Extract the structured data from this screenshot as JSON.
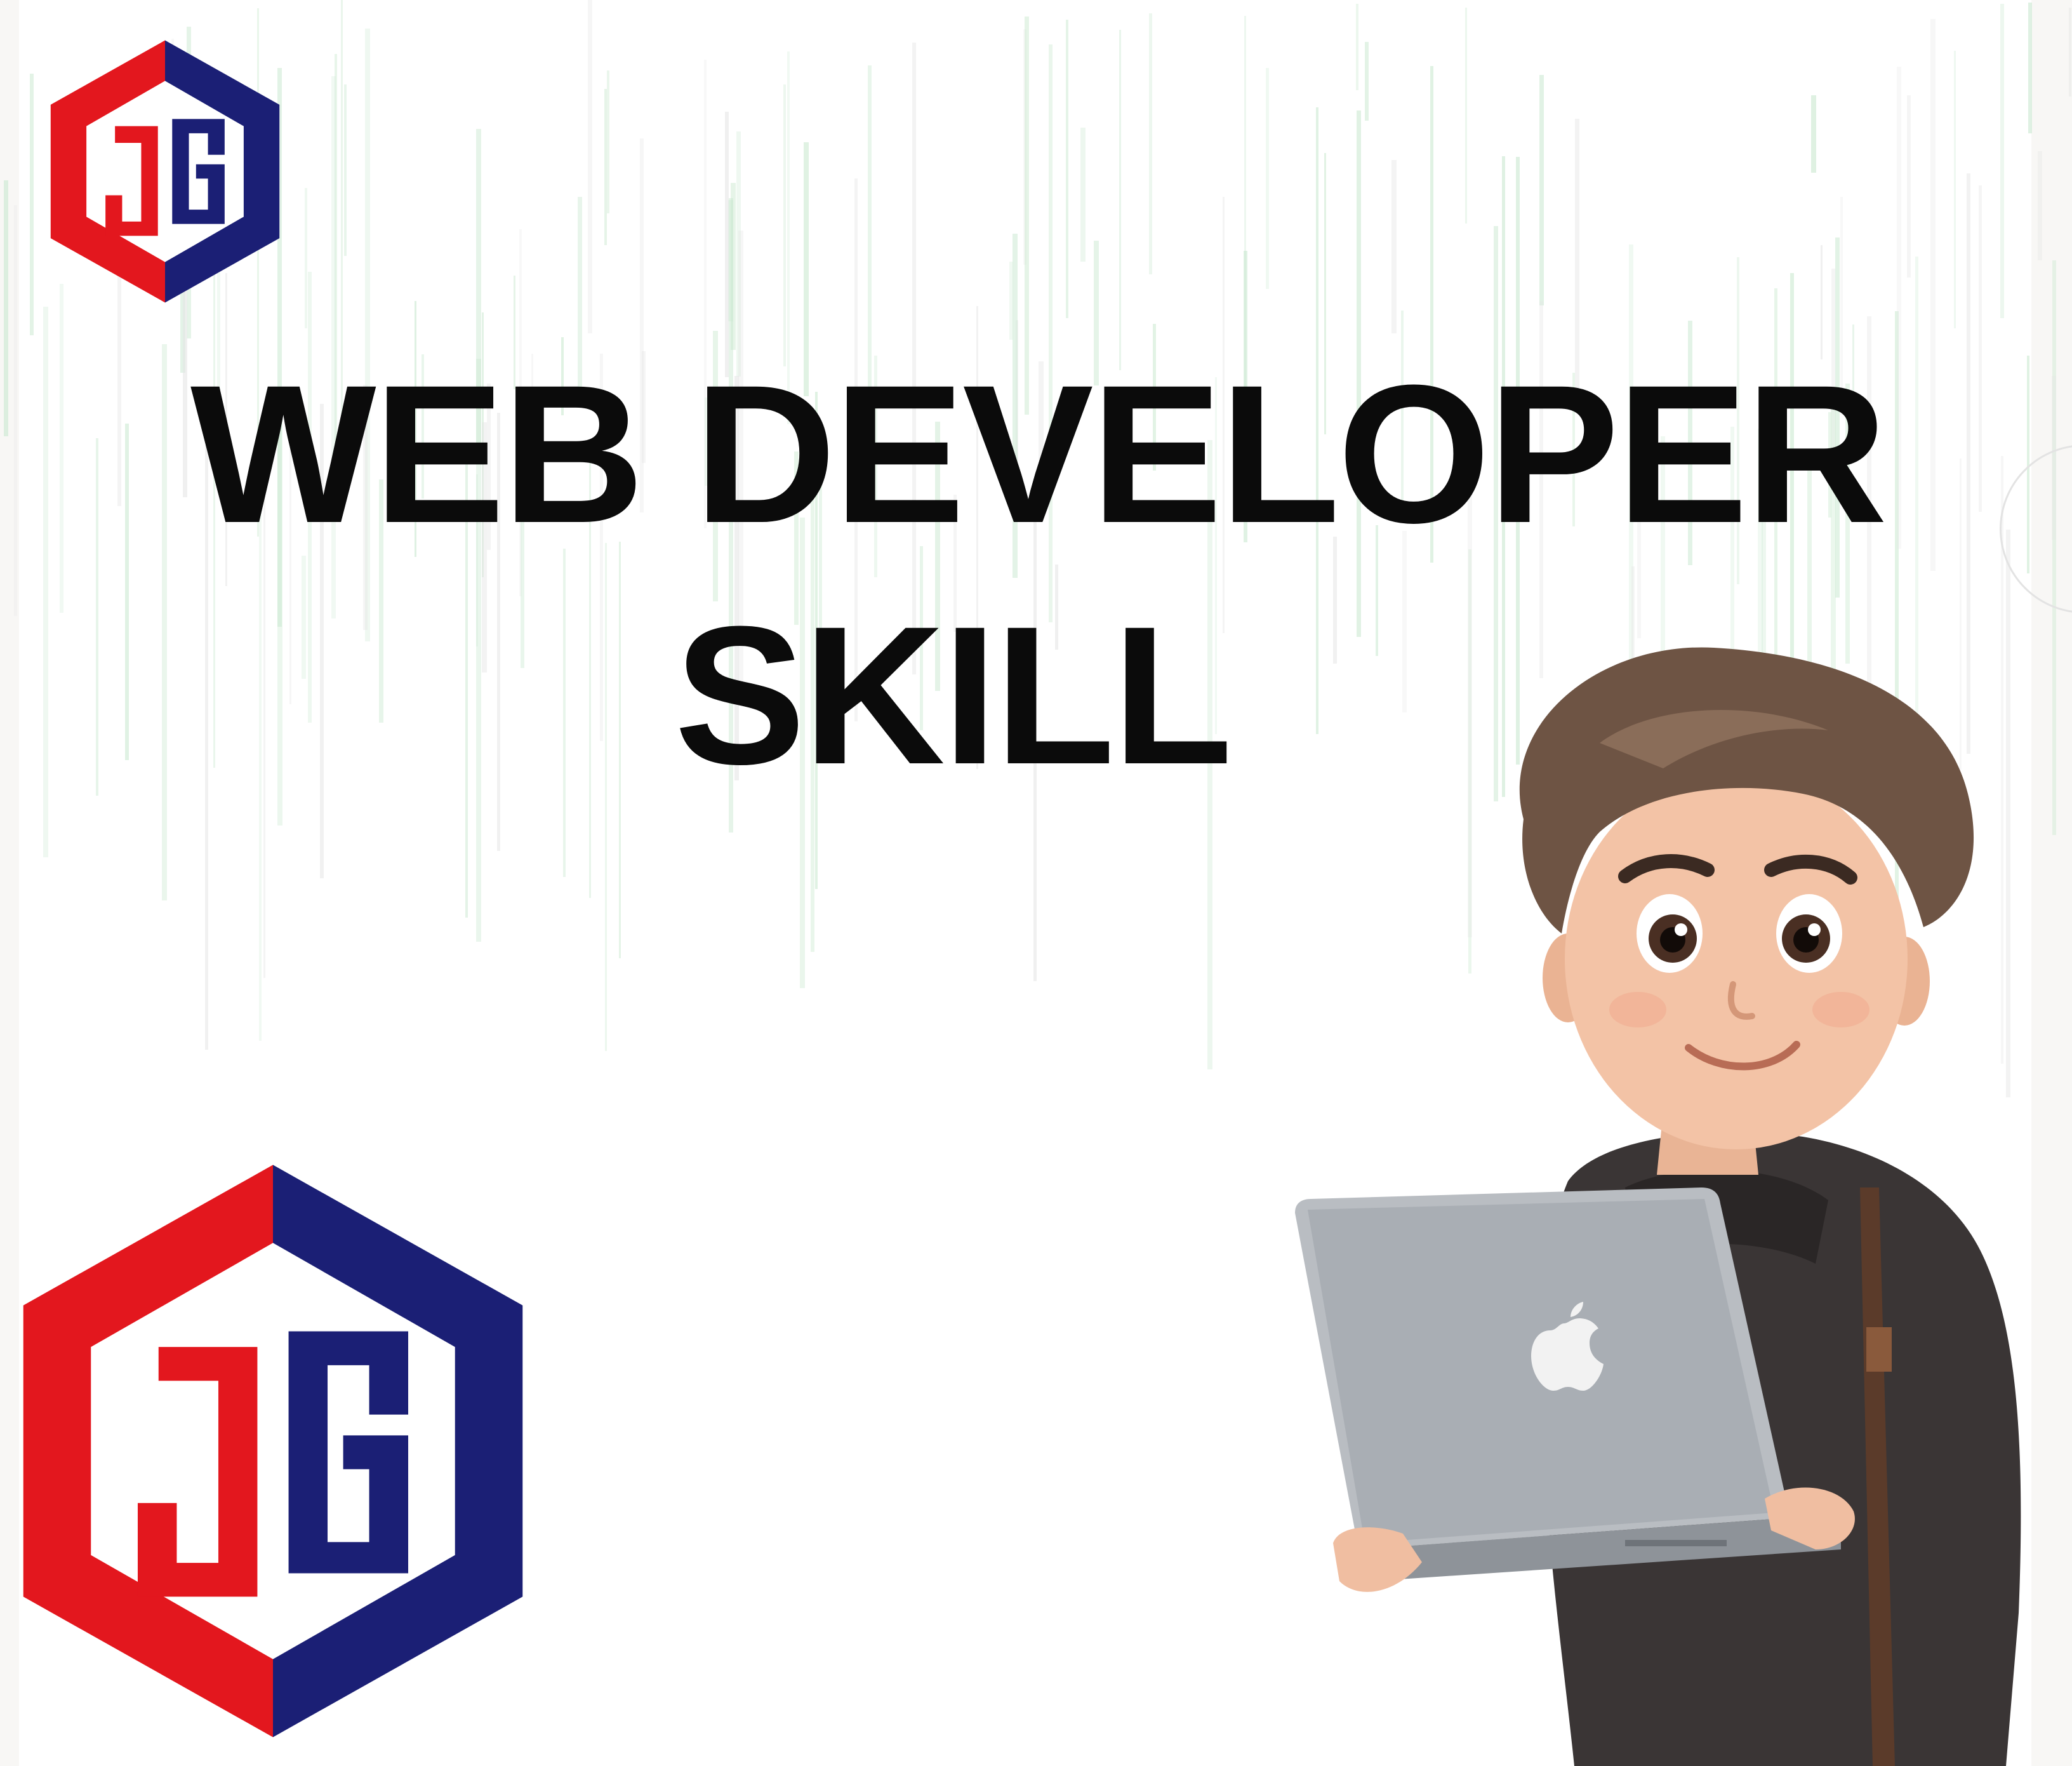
{
  "headline": {
    "line1": "WEB DEVELOPER",
    "line2": "SKILL"
  },
  "logo": {
    "text": "JG",
    "red": "#e3171e",
    "navy": "#1b1f75"
  },
  "colors": {
    "rain": "#c9e8cf",
    "laptop": "#b9bdc2",
    "hoodie": "#3a3535",
    "hair": "#6e5444",
    "skin": "#f3c3a6"
  },
  "illustration": {
    "subject": "boy-holding-laptop",
    "laptop_logo": "apple-icon"
  }
}
